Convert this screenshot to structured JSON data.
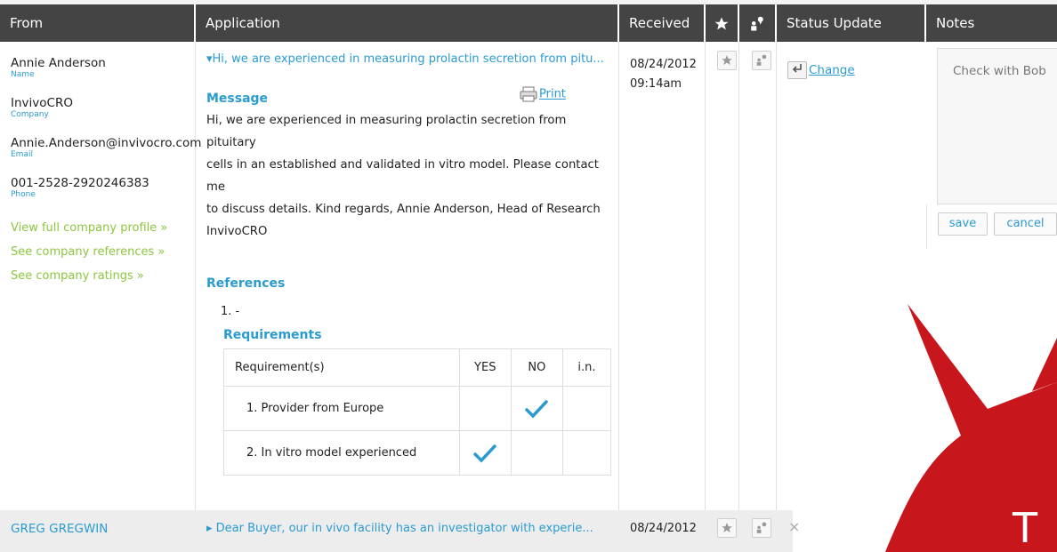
{
  "header": {
    "from": "From",
    "application": "Application",
    "received": "Received",
    "star_icon": "star-icon",
    "flag_icon": "person-flag-icon",
    "status_update": "Status Update",
    "notes": "Notes"
  },
  "row1": {
    "from": {
      "name": "Annie Anderson",
      "name_label": "Name",
      "company": "InvivoCRO",
      "company_label": "Company",
      "email": "Annie.Anderson@invivocro.com",
      "email_label": "Email",
      "phone": "001-2528-2920246383",
      "phone_label": "Phone",
      "links": [
        "View full company profile »",
        "See company references »",
        "See company ratings »"
      ]
    },
    "application": {
      "subject": "▾Hi, we are experienced in measuring prolactin secretion from pitu...",
      "message_title": "Message",
      "print_label": "Print",
      "message_lines": [
        "Hi, we are experienced in measuring prolactin secretion from pituitary",
        "cells in an established and validated in vitro model. Please contact me",
        "to discuss details. Kind regards, Annie Anderson, Head of Research",
        "InvivoCRO"
      ],
      "references_title": "References",
      "references_item": "1. -",
      "requirements_title": "Requirements",
      "requirements_headers": [
        "Requirement(s)",
        "YES",
        "NO",
        "i.n."
      ],
      "requirements": [
        {
          "name": "1. Provider from Europe",
          "answer": "NO"
        },
        {
          "name": "2. In vitro model experienced",
          "answer": "YES"
        }
      ]
    },
    "received_date": "08/24/2012",
    "received_time": "09:14am",
    "status_change": "Change",
    "notes_text": "Check with Bob",
    "save_label": "save",
    "cancel_label": "cancel"
  },
  "row2": {
    "from": "GREG GREGWIN",
    "subject": "▸ Dear Buyer, our in vivo facility has an investigator with experie...",
    "received_date": "08/24/2012",
    "close": "×"
  },
  "colors": {
    "header_bg": "#444444",
    "accent_blue": "#2a9bd0",
    "link_green": "#8cc63f",
    "logo_red": "#c8161d"
  },
  "logo_letter": "T"
}
